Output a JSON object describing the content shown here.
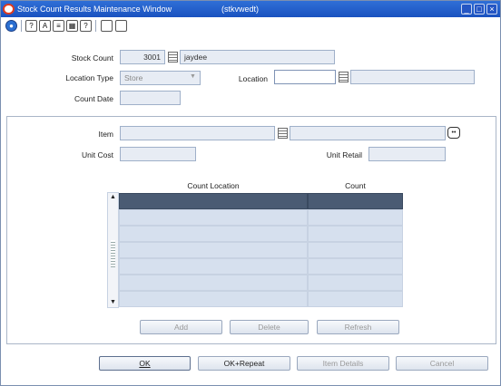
{
  "window": {
    "title": "Stock Count Results Maintenance Window",
    "id": "(stkvwedt)"
  },
  "toolbar": {
    "icons": [
      "globe-icon",
      "help-icon",
      "spell-icon",
      "notes-icon",
      "calendar-icon",
      "about-icon",
      "new-record-icon",
      "open-record-icon"
    ]
  },
  "header": {
    "stock_count_label": "Stock Count",
    "stock_count_value": "3001",
    "stock_count_desc": "jaydee",
    "location_type_label": "Location Type",
    "location_type_value": "Store",
    "location_label": "Location",
    "location_value": "",
    "location_desc": "",
    "count_date_label": "Count Date",
    "count_date_value": ""
  },
  "item_section": {
    "item_label": "Item",
    "item_value": "",
    "item_desc": "",
    "unit_cost_label": "Unit Cost",
    "unit_cost_value": "",
    "unit_retail_label": "Unit Retail",
    "unit_retail_value": ""
  },
  "grid": {
    "columns": [
      "Count Location",
      "Count"
    ],
    "rows": [
      [
        "",
        ""
      ],
      [
        "",
        ""
      ],
      [
        "",
        ""
      ],
      [
        "",
        ""
      ],
      [
        "",
        ""
      ],
      [
        "",
        ""
      ],
      [
        "",
        ""
      ]
    ]
  },
  "grid_buttons": {
    "add": "Add",
    "delete": "Delete",
    "refresh": "Refresh"
  },
  "footer_buttons": {
    "ok": "OK",
    "ok_repeat": "OK+Repeat",
    "item_details": "Item Details",
    "cancel": "Cancel"
  },
  "colors": {
    "titlebar": "#1a52c0",
    "field_bg": "#e7ecf4",
    "grid_row": "#d6e0ee",
    "grid_selected": "#4a5b73"
  }
}
